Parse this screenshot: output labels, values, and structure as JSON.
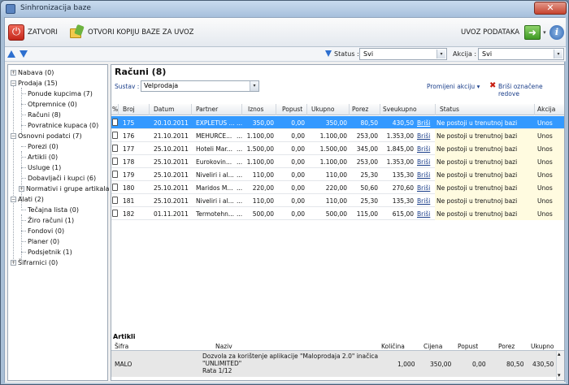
{
  "window": {
    "title": "Sinhronizacija baze",
    "close_glyph": "✕"
  },
  "toolbar": {
    "close_label": "ZATVORI",
    "open_copy_label": "OTVORI KOPIJU BAZE ZA UVOZ",
    "import_label": "UVOZ PODATAKA",
    "power_glyph": "⏻",
    "import_glyph": "➜",
    "info_glyph": "i",
    "dropdown_glyph": "▾"
  },
  "filter": {
    "status_label": "Status :",
    "status_value": "Svi",
    "akcija_label": "Akcija :",
    "akcija_value": "Svi",
    "dd_glyph": "▾"
  },
  "tree": {
    "expander_plus": "+",
    "expander_minus": "−",
    "nabava": "Nabava (0)",
    "prodaja": "Prodaja (15)",
    "ponude": "Ponude kupcima (7)",
    "otpremnice": "Otpremnice (0)",
    "racuni": "Računi (8)",
    "povratnice": "Povratnice kupaca (0)",
    "osnovni": "Osnovni podatci (7)",
    "porezi": "Porezi (0)",
    "artikli": "Artikli (0)",
    "usluge": "Usluge (1)",
    "dobavljaci": "Dobavljači i kupci (6)",
    "normativi": "Normativi i grupe artikala (0)",
    "alati": "Alati (2)",
    "tecajna": "Tečajna lista (0)",
    "ziro": "Žiro računi (1)",
    "fondovi": "Fondovi (0)",
    "planer": "Planer (0)",
    "podsjetnik": "Podsjetnik (1)",
    "sifrarnici": "Šifrarnici (0)"
  },
  "main": {
    "title": "Računi (8)",
    "sustav_label": "Sustav :",
    "sustav_value": "Velprodaja",
    "change_action": "Promijeni akciju",
    "change_dd": "▾",
    "delete_marked": "Briši označene redove",
    "delete_icon": "✖"
  },
  "grid": {
    "columns": [
      "%",
      "Broj",
      "Datum",
      "Partner",
      "Iznos",
      "Popust",
      "Ukupno",
      "Porez",
      "Sveukupno",
      "Status",
      "Akcija"
    ],
    "rows": [
      {
        "broj": "175",
        "datum": "20.10.2011",
        "partner": "EXPLETUS ...",
        "dots": "...",
        "iznos": "350,00",
        "popust": "0,00",
        "ukupno": "350,00",
        "porez": "80,50",
        "sveukupno": "430,50",
        "link": "Briši",
        "status": "Ne postoji u trenutnoj bazi",
        "akcija": "Unos"
      },
      {
        "broj": "176",
        "datum": "21.10.2011",
        "partner": "MEHURĆE...",
        "dots": "...",
        "iznos": "1.100,00",
        "popust": "0,00",
        "ukupno": "1.100,00",
        "porez": "253,00",
        "sveukupno": "1.353,00",
        "link": "Briši",
        "status": "Ne postoji u trenutnoj bazi",
        "akcija": "Unos"
      },
      {
        "broj": "177",
        "datum": "25.10.2011",
        "partner": "Hoteli Mar...",
        "dots": "...",
        "iznos": "1.500,00",
        "popust": "0,00",
        "ukupno": "1.500,00",
        "porez": "345,00",
        "sveukupno": "1.845,00",
        "link": "Briši",
        "status": "Ne postoji u trenutnoj bazi",
        "akcija": "Unos"
      },
      {
        "broj": "178",
        "datum": "25.10.2011",
        "partner": "Eurokovin...",
        "dots": "...",
        "iznos": "1.100,00",
        "popust": "0,00",
        "ukupno": "1.100,00",
        "porez": "253,00",
        "sveukupno": "1.353,00",
        "link": "Briši",
        "status": "Ne postoji u trenutnoj bazi",
        "akcija": "Unos"
      },
      {
        "broj": "179",
        "datum": "25.10.2011",
        "partner": "Niveliri i al...",
        "dots": "...",
        "iznos": "110,00",
        "popust": "0,00",
        "ukupno": "110,00",
        "porez": "25,30",
        "sveukupno": "135,30",
        "link": "Briši",
        "status": "Ne postoji u trenutnoj bazi",
        "akcija": "Unos"
      },
      {
        "broj": "180",
        "datum": "25.10.2011",
        "partner": "Maridos M...",
        "dots": "...",
        "iznos": "220,00",
        "popust": "0,00",
        "ukupno": "220,00",
        "porez": "50,60",
        "sveukupno": "270,60",
        "link": "Briši",
        "status": "Ne postoji u trenutnoj bazi",
        "akcija": "Unos"
      },
      {
        "broj": "181",
        "datum": "25.10.2011",
        "partner": "Niveliri i al...",
        "dots": "...",
        "iznos": "110,00",
        "popust": "0,00",
        "ukupno": "110,00",
        "porez": "25,30",
        "sveukupno": "135,30",
        "link": "Briši",
        "status": "Ne postoji u trenutnoj bazi",
        "akcija": "Unos"
      },
      {
        "broj": "182",
        "datum": "01.11.2011",
        "partner": "Termotehn...",
        "dots": "...",
        "iznos": "500,00",
        "popust": "0,00",
        "ukupno": "500,00",
        "porez": "115,00",
        "sveukupno": "615,00",
        "link": "Briši",
        "status": "Ne postoji u trenutnoj bazi",
        "akcija": "Unos"
      }
    ]
  },
  "artikli": {
    "title": "Artikli",
    "columns": [
      "Šifra",
      "Naziv",
      "Količina",
      "Cijena",
      "Popust",
      "Porez",
      "Ukupno"
    ],
    "row": {
      "sifra": "MALO",
      "naziv_1": "Dozvola za korištenje aplikacije \"Maloprodaja 2.0\" inačica",
      "naziv_2": "\"UNLIMITED\"",
      "naziv_3": "Rata 1/12",
      "kolicina": "1,000",
      "cijena": "350,00",
      "popust": "0,00",
      "porez": "80,50",
      "ukupno": "430,50"
    },
    "scroll_up": "▴",
    "scroll_down": "▾"
  },
  "colors": {
    "selection": "#3399ff",
    "link": "#1a3e8a",
    "accent": "#2d6fcf"
  }
}
